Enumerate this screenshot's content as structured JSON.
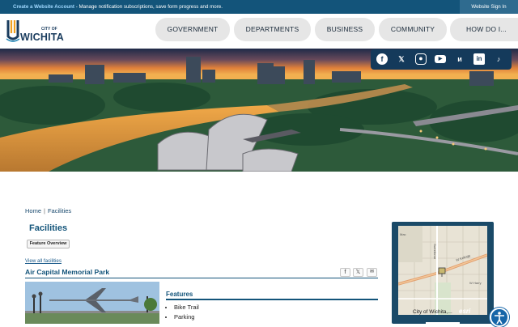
{
  "topbar": {
    "link": "Create a Website Account",
    "message": " - Manage notification subscriptions, save form progress and more.",
    "signin": "Website Sign In"
  },
  "logo": {
    "city_of": "CITY OF",
    "name": "WICHITA"
  },
  "nav": [
    "GOVERNMENT",
    "DEPARTMENTS",
    "BUSINESS",
    "COMMUNITY",
    "HOW DO I..."
  ],
  "social": [
    "facebook-icon",
    "x-icon",
    "instagram-icon",
    "youtube-icon",
    "nextdoor-icon",
    "linkedin-icon",
    "tiktok-icon"
  ],
  "breadcrumb": {
    "home": "Home",
    "separator": "|",
    "current": "Facilities"
  },
  "page_title": "Facilities",
  "feature_overview": "Feature Overview",
  "view_all": "View all facilities",
  "facility": {
    "name": "Air Capital Memorial Park",
    "features_heading": "Features",
    "features": [
      "Bike Trail",
      "Parking"
    ]
  },
  "map": {
    "caption": "City of Wichita,...",
    "esri": "esri",
    "labels": [
      "Sweetbriar",
      "W Kellogg",
      "W Harry",
      "Mac"
    ]
  },
  "colors": {
    "topbar": "#13547a",
    "accent": "#13547a",
    "map_frame": "#1a4a68"
  }
}
